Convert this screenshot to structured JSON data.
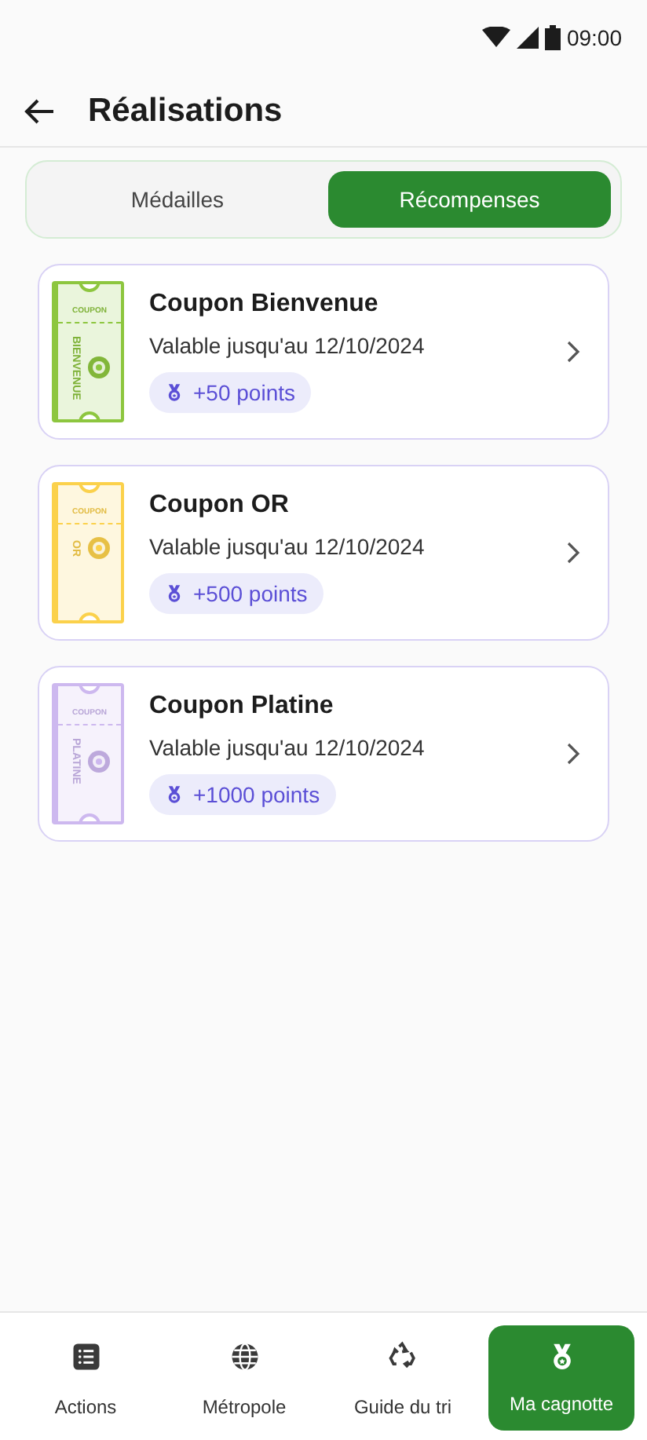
{
  "status_bar": {
    "time": "09:00"
  },
  "header": {
    "title": "Réalisations"
  },
  "tabs": [
    {
      "label": "Médailles",
      "selected": false
    },
    {
      "label": "Récompenses",
      "selected": true
    }
  ],
  "coupons": [
    {
      "ticket_header": "COUPON",
      "ticket_name": "BIENVENUE",
      "color": "#8dc63f",
      "title": "Coupon Bienvenue",
      "validity": "Valable jusqu'au 12/10/2024",
      "points": "+50 points"
    },
    {
      "ticket_header": "COUPON",
      "ticket_name": "OR",
      "color": "#fbd14b",
      "title": "Coupon OR",
      "validity": "Valable jusqu'au 12/10/2024",
      "points": "+500 points"
    },
    {
      "ticket_header": "COUPON",
      "ticket_name": "PLATINE",
      "color": "#cdb8ef",
      "title": "Coupon Platine",
      "validity": "Valable jusqu'au 12/10/2024",
      "points": "+1000 points"
    }
  ],
  "bottom_nav": [
    {
      "kind": "list",
      "label": "Actions",
      "selected": false
    },
    {
      "kind": "globe",
      "label": "Métropole",
      "selected": false
    },
    {
      "kind": "recycle",
      "label": "Guide du tri",
      "selected": false
    },
    {
      "kind": "medal",
      "label": "Ma cagnotte",
      "selected": true
    }
  ]
}
